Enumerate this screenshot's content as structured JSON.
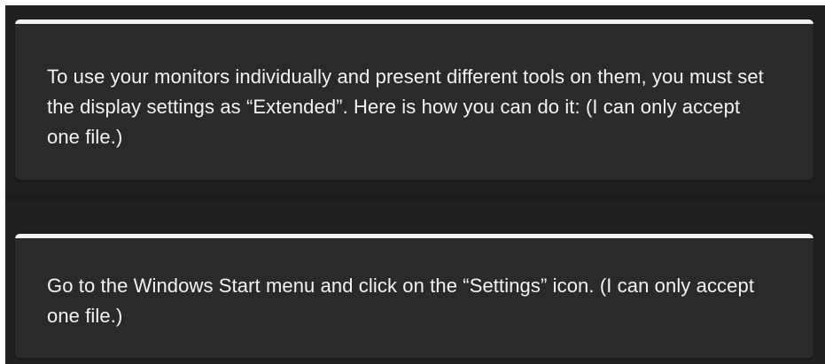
{
  "messages": [
    {
      "text": "To use your monitors individually and present different tools on them, you must set the display settings as “Extended”. Here is how you can do it: (I can only accept one file.)"
    },
    {
      "text": "Go to the Windows Start menu and click on the “Settings” icon. (I can only accept one file.)"
    }
  ],
  "colors": {
    "background": "#202020",
    "card": "#2a2a2a",
    "accent_bar": "#f2f2f2",
    "text": "#f3f3f3"
  }
}
